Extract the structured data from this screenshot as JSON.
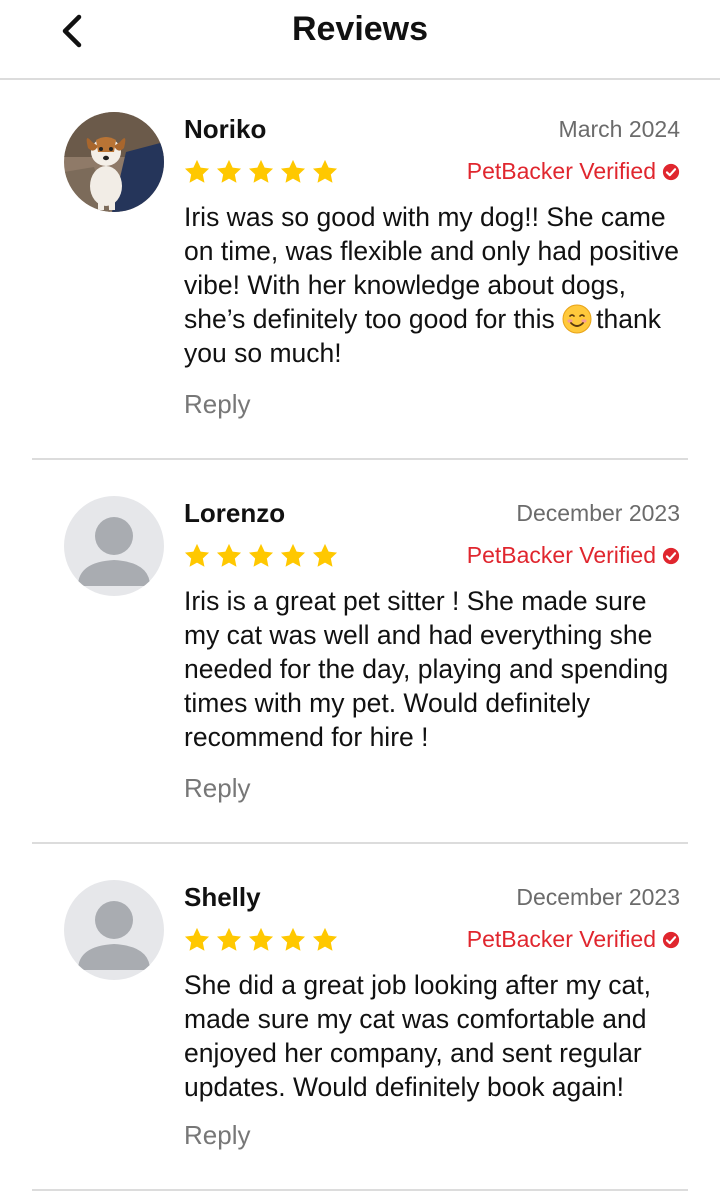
{
  "header": {
    "title": "Reviews",
    "back_icon": "chevron-left-icon"
  },
  "reviews": [
    {
      "name": "Noriko",
      "date": "March 2024",
      "rating": 5,
      "verified_label": "PetBacker Verified",
      "text": "Iris was so good with my dog!! She came on time, was flexible and only had positive vibe! With her knowledge about dogs, she’s definitely too good for this",
      "text_after_emoji": "thank you so much!",
      "emoji": "smiling-face-emoji",
      "avatar": "dog-photo-avatar",
      "reply_label": "Reply"
    },
    {
      "name": "Lorenzo",
      "date": "December 2023",
      "rating": 5,
      "verified_label": "PetBacker Verified",
      "text": "Iris is a great pet sitter ! She made sure my cat was well and had everything she needed for the day, playing and spending times with my pet. Would definitely recommend for hire !",
      "avatar": "default-user-avatar",
      "reply_label": "Reply"
    },
    {
      "name": "Shelly",
      "date": "December 2023",
      "rating": 5,
      "verified_label": "PetBacker Verified",
      "text": "She did a great job looking after my cat, made sure my cat was comfortable and enjoyed her company, and sent regular updates. Would definitely book again!",
      "avatar": "default-user-avatar",
      "reply_label": "Reply"
    }
  ],
  "colors": {
    "star": "#FFC800",
    "verified": "#E0262E",
    "reply": "#777777",
    "date": "#6B6B6B",
    "divider": "#DCDCDC"
  }
}
